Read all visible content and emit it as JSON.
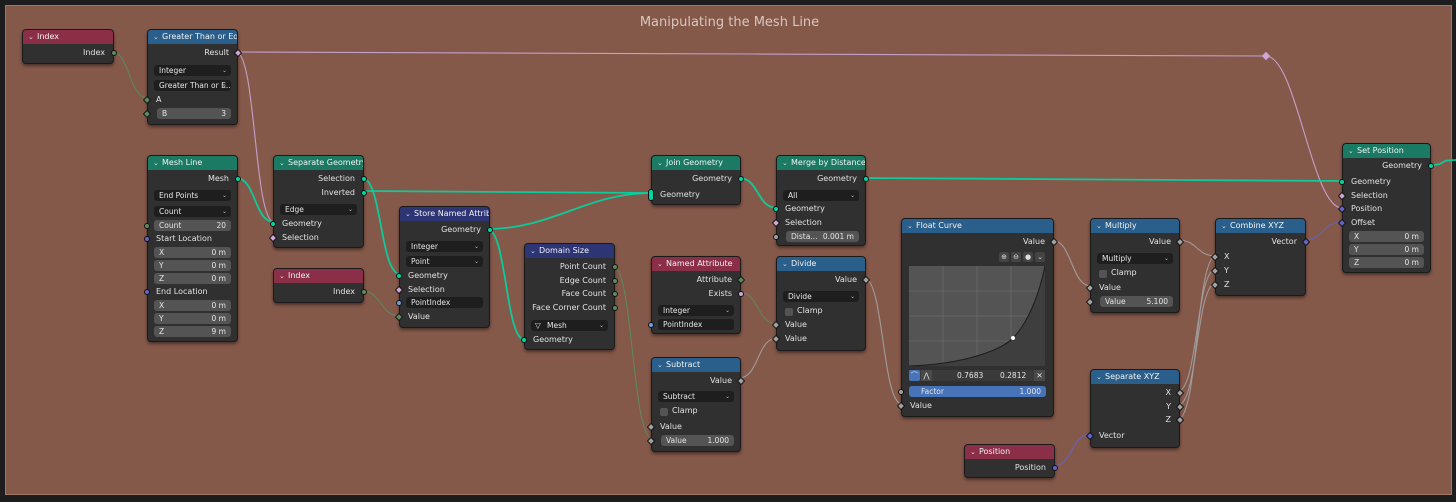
{
  "frame": {
    "title": "Manipulating the Mesh Line"
  },
  "nodes": {
    "index1": {
      "title": "Index",
      "out": "Index"
    },
    "gte": {
      "title": "Greater Than or Equal",
      "out": "Result",
      "type": "Integer",
      "op": "Greater Than or E...",
      "a": "A",
      "b_label": "B",
      "b_value": "3"
    },
    "meshline": {
      "title": "Mesh Line",
      "out": "Mesh",
      "mode": "End Points",
      "count_mode": "Count",
      "count_label": "Count",
      "count_value": "20",
      "start": "Start Location",
      "end": "End Location",
      "sx": "0 m",
      "sy": "0 m",
      "sz": "0 m",
      "ex": "0 m",
      "ey": "0 m",
      "ez": "9 m",
      "x": "X",
      "y": "Y",
      "z": "Z"
    },
    "sepgeo": {
      "title": "Separate Geometry",
      "out1": "Selection",
      "out2": "Inverted",
      "domain": "Edge",
      "in1": "Geometry",
      "in2": "Selection"
    },
    "index2": {
      "title": "Index",
      "out": "Index"
    },
    "store": {
      "title": "Store Named Attrib...",
      "out": "Geometry",
      "type": "Integer",
      "domain": "Point",
      "in1": "Geometry",
      "in2": "Selection",
      "name": "PointIndex",
      "in3": "Value"
    },
    "domainsize": {
      "title": "Domain Size",
      "o1": "Point Count",
      "o2": "Edge Count",
      "o3": "Face Count",
      "o4": "Face Corner Count",
      "type": "Mesh",
      "in": "Geometry"
    },
    "join": {
      "title": "Join Geometry",
      "out": "Geometry",
      "in": "Geometry"
    },
    "namedattr": {
      "title": "Named Attribute",
      "o1": "Attribute",
      "o2": "Exists",
      "type": "Integer",
      "name": "PointIndex"
    },
    "subtract": {
      "title": "Subtract",
      "out": "Value",
      "op": "Subtract",
      "clamp": "Clamp",
      "in": "Value",
      "vlabel": "Value",
      "vvalue": "1.000"
    },
    "merge": {
      "title": "Merge by Distance",
      "out": "Geometry",
      "mode": "All",
      "in1": "Geometry",
      "in2": "Selection",
      "dlabel": "Dista...",
      "dvalue": "0.001 m"
    },
    "divide": {
      "title": "Divide",
      "out": "Value",
      "op": "Divide",
      "clamp": "Clamp",
      "in1": "Value",
      "in2": "Value"
    },
    "floatcurve": {
      "title": "Float Curve",
      "out": "Value",
      "px": "0.7683",
      "py": "0.2812",
      "factor_label": "Factor",
      "factor_value": "1.000",
      "in": "Value"
    },
    "multiply": {
      "title": "Multiply",
      "out": "Value",
      "op": "Multiply",
      "clamp": "Clamp",
      "in": "Value",
      "vlabel": "Value",
      "vvalue": "5.100"
    },
    "sepxyz": {
      "title": "Separate XYZ",
      "o1": "X",
      "o2": "Y",
      "o3": "Z",
      "in": "Vector"
    },
    "position": {
      "title": "Position",
      "out": "Position"
    },
    "combxyz": {
      "title": "Combine XYZ",
      "out": "Vector",
      "i1": "X",
      "i2": "Y",
      "i3": "Z"
    },
    "setpos": {
      "title": "Set Position",
      "out": "Geometry",
      "i1": "Geometry",
      "i2": "Selection",
      "i3": "Position",
      "i4": "Offset",
      "ox": "0 m",
      "oy": "0 m",
      "oz": "0 m",
      "x": "X",
      "y": "Y",
      "z": "Z"
    }
  },
  "colors": {
    "frame": "#85594a",
    "geometry": "#00d6a3",
    "vector": "#6363c7",
    "float": "#a1a1a1",
    "integer": "#598c5c",
    "boolean": "#cca6d6"
  },
  "icons": {
    "collapse": "chevron-down-icon",
    "mesh_type": "triangle-down-icon"
  }
}
